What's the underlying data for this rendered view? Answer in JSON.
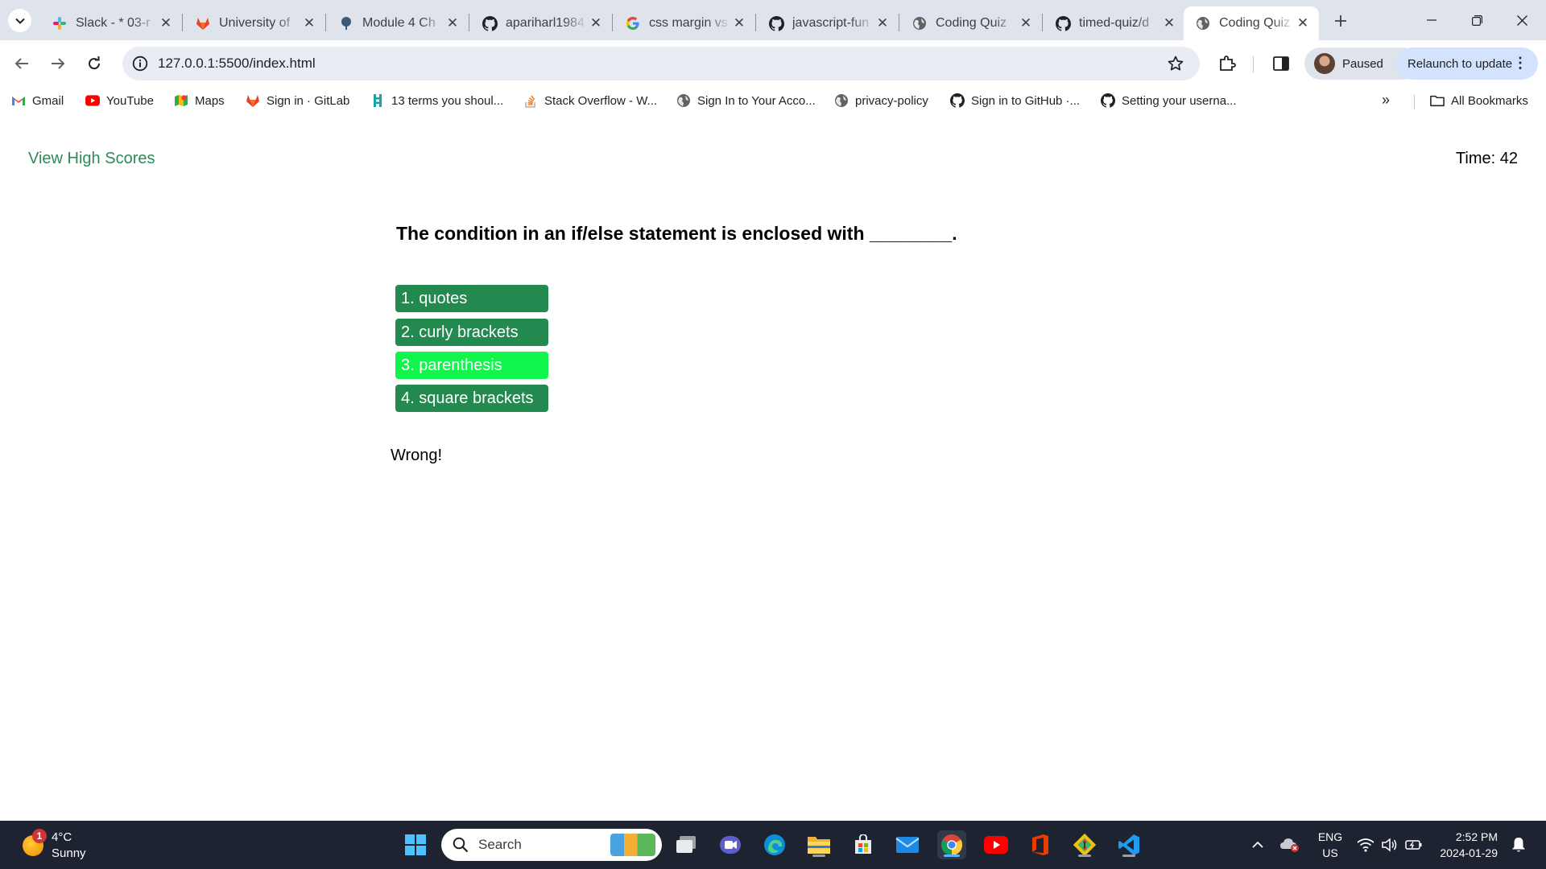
{
  "browser": {
    "tabs": [
      {
        "title": "Slack - * 03-r",
        "icon": "slack-icon"
      },
      {
        "title": "University of",
        "icon": "gitlab-icon"
      },
      {
        "title": "Module 4 Ch",
        "icon": "module-icon"
      },
      {
        "title": "apariharl1984",
        "icon": "github-icon"
      },
      {
        "title": "css margin vs",
        "icon": "google-icon"
      },
      {
        "title": "javascript-fun",
        "icon": "github-icon"
      },
      {
        "title": "Coding Quiz",
        "icon": "globe-icon"
      },
      {
        "title": "timed-quiz/d",
        "icon": "github-icon"
      },
      {
        "title": "Coding Quiz",
        "icon": "globe-icon",
        "active": true
      }
    ],
    "url": "127.0.0.1:5500/index.html",
    "profile_status": "Paused",
    "relaunch_label": "Relaunch to update",
    "bookmarks": [
      {
        "label": "Gmail",
        "icon": "gmail-icon"
      },
      {
        "label": "YouTube",
        "icon": "youtube-icon"
      },
      {
        "label": "Maps",
        "icon": "maps-icon"
      },
      {
        "label": "Sign in · GitLab",
        "icon": "gitlab-icon"
      },
      {
        "label": "13 terms you shoul...",
        "icon": "bookmark-icon"
      },
      {
        "label": "Stack Overflow - W...",
        "icon": "stackoverflow-icon"
      },
      {
        "label": "Sign In to Your Acco...",
        "icon": "globe-icon"
      },
      {
        "label": "privacy-policy",
        "icon": "globe-icon"
      },
      {
        "label": "Sign in to GitHub ·...",
        "icon": "github-icon"
      },
      {
        "label": "Setting your userna...",
        "icon": "github-icon"
      }
    ],
    "all_bookmarks_label": "All Bookmarks"
  },
  "quiz": {
    "high_scores_link": "View High Scores",
    "timer_label": "Time: 42",
    "question": "The condition in an if/else statement is enclosed with ________.",
    "choices": [
      "1. quotes",
      "2. curly brackets",
      "3. parenthesis",
      "4. square brackets"
    ],
    "feedback": "Wrong!",
    "colors": {
      "button": "#22894f",
      "button_hover": "#12f54c",
      "link": "#2e8b57"
    }
  },
  "taskbar": {
    "weather_badge": "1",
    "weather_temp": "4°C",
    "weather_condition": "Sunny",
    "search_placeholder": "Search",
    "lang_line1": "ENG",
    "lang_line2": "US",
    "time": "2:52 PM",
    "date": "2024-01-29"
  }
}
